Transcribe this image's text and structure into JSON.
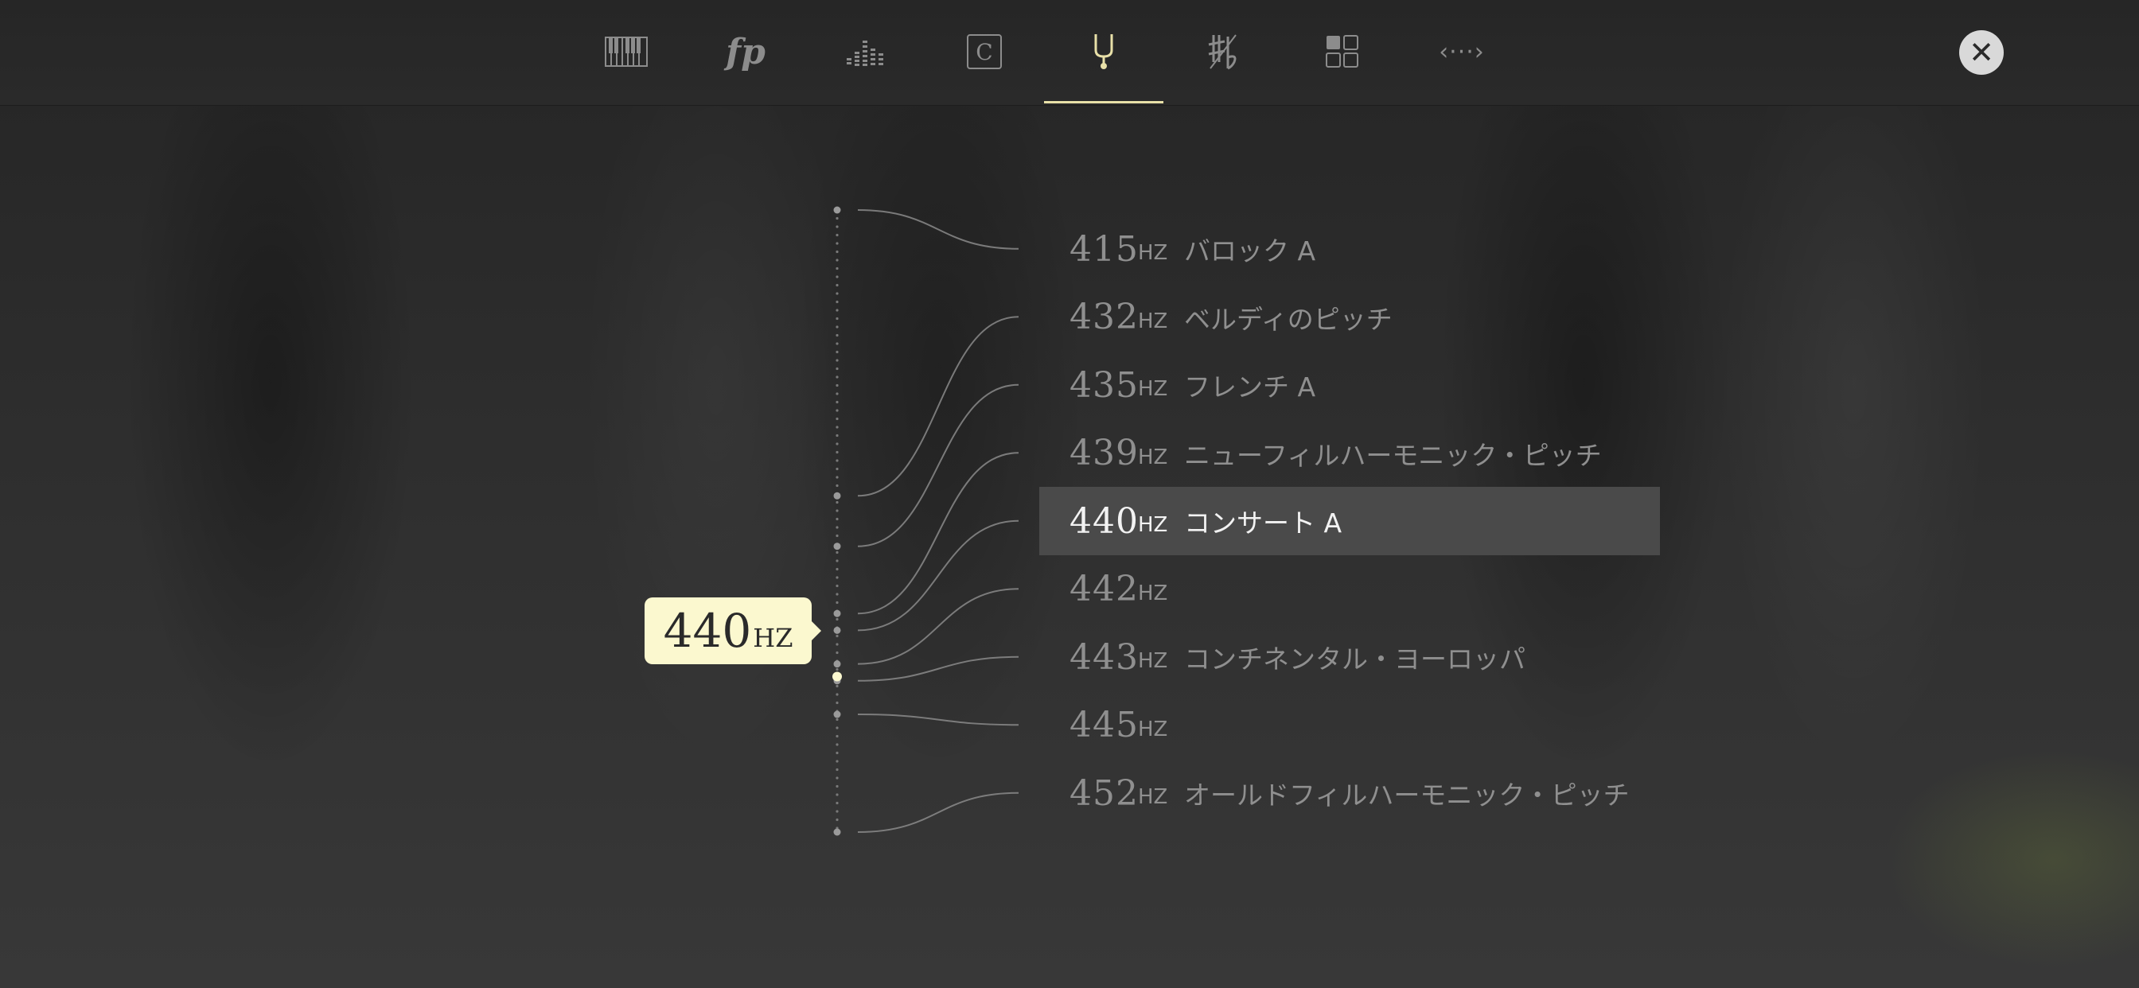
{
  "toolbar": {
    "tabs": [
      {
        "icon": "piano-keyboard-icon"
      },
      {
        "icon": "dynamics-fp-icon",
        "glyph": "fp"
      },
      {
        "icon": "equalizer-icon"
      },
      {
        "icon": "key-c-icon",
        "glyph": "C"
      },
      {
        "icon": "tuning-fork-icon",
        "active": true
      },
      {
        "icon": "temperament-icon"
      },
      {
        "icon": "grid-layout-icon"
      },
      {
        "icon": "more-code-icon",
        "glyph": "‹···›"
      }
    ],
    "close_icon": "close-icon"
  },
  "slider": {
    "current_value": "440",
    "current_unit": "HZ",
    "current_position": 0.75
  },
  "pitch_list": {
    "items": [
      {
        "hz": "415",
        "unit": "HZ",
        "label": "バロック A"
      },
      {
        "hz": "432",
        "unit": "HZ",
        "label": "ベルディのピッチ"
      },
      {
        "hz": "435",
        "unit": "HZ",
        "label": "フレンチ A"
      },
      {
        "hz": "439",
        "unit": "HZ",
        "label": "ニューフィルハーモニック・ピッチ"
      },
      {
        "hz": "440",
        "unit": "HZ",
        "label": "コンサート A",
        "selected": true
      },
      {
        "hz": "442",
        "unit": "HZ",
        "label": ""
      },
      {
        "hz": "443",
        "unit": "HZ",
        "label": "コンチネンタル・ヨーロッパ"
      },
      {
        "hz": "445",
        "unit": "HZ",
        "label": ""
      },
      {
        "hz": "452",
        "unit": "HZ",
        "label": "オールドフィルハーモニック・ピッチ"
      }
    ]
  },
  "colors": {
    "accent": "#e8e0a8",
    "bubble": "#fbf8cf",
    "selected_row": "#4a4a4a",
    "text_dim": "#8f8f8f"
  }
}
